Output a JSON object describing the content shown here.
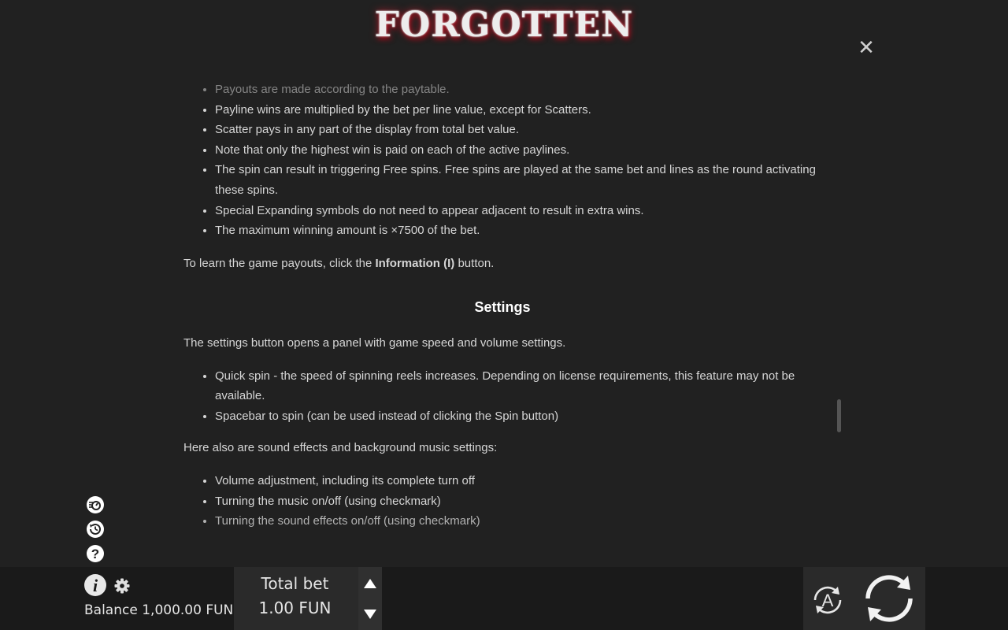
{
  "header": {
    "logo_text": "FORGOTTEN",
    "close_icon": "close-icon"
  },
  "rules": {
    "bullets_top": [
      "Payouts are made according to the paytable.",
      "Payline wins are multiplied by the bet per line value, except for Scatters.",
      "Scatter pays in any part of the display from total bet value.",
      "Note that only the highest win is paid on each of the active paylines.",
      "The spin can result in triggering Free spins. Free spins are played at the same bet and lines as the round activating these spins.",
      "Special Expanding symbols do not need to appear adjacent to result in extra wins.",
      "The maximum winning amount is ×7500 of the bet."
    ],
    "payouts_before": "To learn the game payouts, click the ",
    "payouts_bold": "Information (I)",
    "payouts_after": " button.",
    "settings_heading": "Settings",
    "settings_intro": "The settings button opens a panel with game speed and volume settings.",
    "settings_bullets": [
      "Quick spin - the speed of spinning reels increases. Depending on license requirements, this feature may not be available.",
      "Spacebar to spin (can be used instead of clicking the Spin button)"
    ],
    "sound_intro": "Here also are sound effects and background music settings:",
    "sound_bullets": [
      "Volume adjustment, including its complete turn off",
      "Turning the music on/off (using checkmark)",
      "Turning the sound effects on/off (using checkmark)"
    ]
  },
  "side_icons": [
    "speed-icon",
    "history-icon",
    "help-icon"
  ],
  "footer": {
    "balance_label": "Balance",
    "balance_value": "1,000.00 FUN",
    "total_bet_label": "Total bet",
    "total_bet_value": "1.00 FUN",
    "autoplay_letter": "A",
    "icons": [
      "info-icon",
      "gear-icon",
      "arrow-up-icon",
      "arrow-down-icon",
      "autoplay-icon",
      "spin-icon"
    ]
  },
  "colors": {
    "background": "#212121",
    "text": "#d6d6d6",
    "footer": "#1a1a1a",
    "logo_glow": "#b51b2a"
  }
}
